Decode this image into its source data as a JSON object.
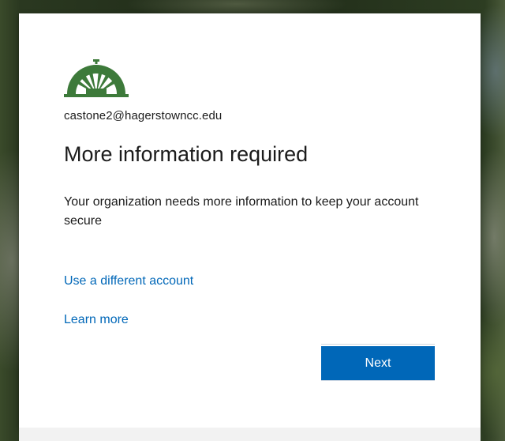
{
  "account": {
    "email": "castone2@hagerstowncc.edu"
  },
  "page": {
    "title": "More information required",
    "description": "Your organization needs more information to keep your account secure"
  },
  "links": {
    "different_account": "Use a different account",
    "learn_more": "Learn more"
  },
  "buttons": {
    "next": "Next"
  },
  "colors": {
    "accent": "#0067b8",
    "logo_green": "#3d7a3a",
    "text": "#1b1b1b"
  },
  "icons": {
    "logo": "college-dome-logo"
  }
}
